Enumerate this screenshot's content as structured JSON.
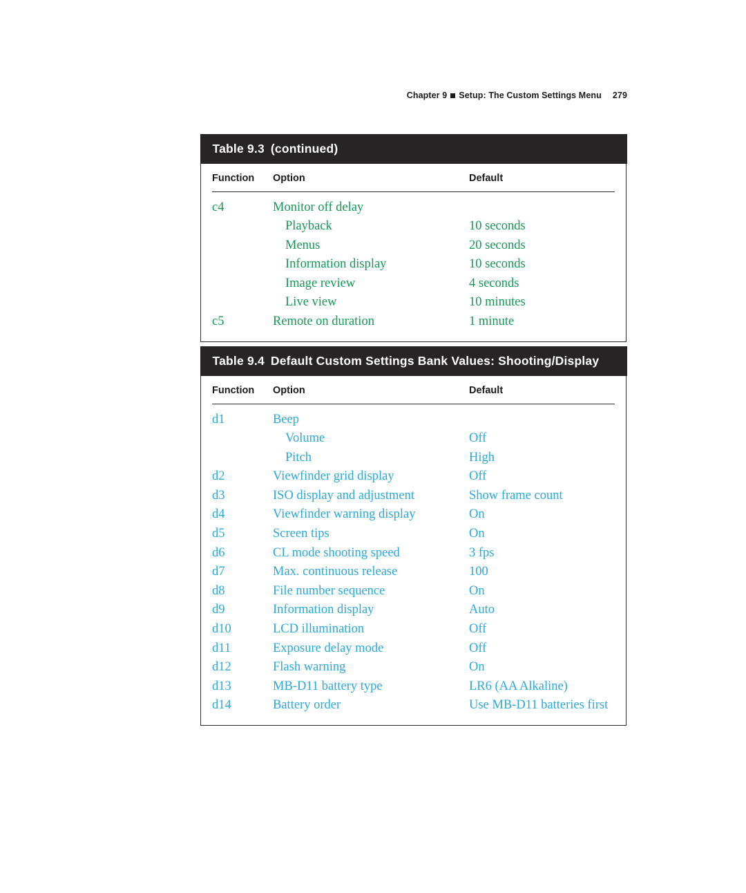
{
  "page_header": {
    "chapter": "Chapter 9",
    "separator_icon": "square-bullet-icon",
    "title": "Setup: The Custom Settings Menu",
    "page_number": "279"
  },
  "colors": {
    "table_93_text": "#149a55",
    "table_94_text": "#29a9e2",
    "title_band": "#272425",
    "rule": "#2b2b2b",
    "page_background": "#ffffff"
  },
  "columns": {
    "function": "Function",
    "option": "Option",
    "default": "Default"
  },
  "tables": [
    {
      "id": "table-93",
      "number": "Table 9.3",
      "caption": "(continued)",
      "rows": [
        {
          "function": "c4",
          "option": "Monitor off delay",
          "default": "",
          "sub": false
        },
        {
          "function": "",
          "option": "Playback",
          "default": "10 seconds",
          "sub": true
        },
        {
          "function": "",
          "option": "Menus",
          "default": "20 seconds",
          "sub": true
        },
        {
          "function": "",
          "option": "Information display",
          "default": "10 seconds",
          "sub": true
        },
        {
          "function": "",
          "option": "Image review",
          "default": "4 seconds",
          "sub": true
        },
        {
          "function": "",
          "option": "Live view",
          "default": "10 minutes",
          "sub": true
        },
        {
          "function": "c5",
          "option": "Remote on duration",
          "default": "1 minute",
          "sub": false
        }
      ]
    },
    {
      "id": "table-94",
      "number": "Table 9.4",
      "caption": "Default Custom Settings Bank Values: Shooting/Display",
      "rows": [
        {
          "function": "d1",
          "option": "Beep",
          "default": "",
          "sub": false
        },
        {
          "function": "",
          "option": "Volume",
          "default": "Off",
          "sub": true
        },
        {
          "function": "",
          "option": "Pitch",
          "default": "High",
          "sub": true
        },
        {
          "function": "d2",
          "option": "Viewfinder grid display",
          "default": "Off",
          "sub": false
        },
        {
          "function": "d3",
          "option": "ISO display and adjustment",
          "default": "Show frame count",
          "sub": false
        },
        {
          "function": "d4",
          "option": "Viewfinder warning display",
          "default": "On",
          "sub": false
        },
        {
          "function": "d5",
          "option": "Screen tips",
          "default": "On",
          "sub": false
        },
        {
          "function": "d6",
          "option": "CL mode shooting speed",
          "default": "3 fps",
          "sub": false
        },
        {
          "function": "d7",
          "option": "Max. continuous release",
          "default": "100",
          "sub": false
        },
        {
          "function": "d8",
          "option": "File number sequence",
          "default": "On",
          "sub": false
        },
        {
          "function": "d9",
          "option": "Information display",
          "default": "Auto",
          "sub": false
        },
        {
          "function": "d10",
          "option": "LCD illumination",
          "default": "Off",
          "sub": false
        },
        {
          "function": "d11",
          "option": "Exposure delay mode",
          "default": "Off",
          "sub": false
        },
        {
          "function": "d12",
          "option": "Flash warning",
          "default": "On",
          "sub": false
        },
        {
          "function": "d13",
          "option": "MB-D11 battery type",
          "default": "LR6 (AA Alkaline)",
          "sub": false
        },
        {
          "function": "d14",
          "option": "Battery order",
          "default": "Use MB-D11 batteries first",
          "sub": false
        }
      ]
    }
  ]
}
